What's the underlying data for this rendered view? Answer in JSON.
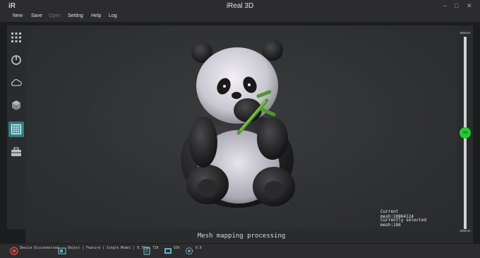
{
  "app": {
    "logo": "iR",
    "title": "iReal 3D"
  },
  "window_controls": {
    "minimize": "–",
    "maximize": "□",
    "close": "✕"
  },
  "menu": [
    {
      "label": "New",
      "enabled": true
    },
    {
      "label": "Save",
      "enabled": true
    },
    {
      "label": "Open",
      "enabled": false
    },
    {
      "label": "Setting",
      "enabled": true
    },
    {
      "label": "Help",
      "enabled": true
    },
    {
      "label": "Log",
      "enabled": true
    }
  ],
  "sidebar": {
    "items": [
      {
        "icon": "grid-dots-icon",
        "active": false
      },
      {
        "icon": "power-cycle-icon",
        "active": false
      },
      {
        "icon": "cloud-icon",
        "active": false
      },
      {
        "icon": "cube-icon",
        "active": false
      },
      {
        "icon": "mesh-grid-icon",
        "active": true
      },
      {
        "icon": "toolbox-icon",
        "active": false
      }
    ]
  },
  "viewport": {
    "current_mesh": "Current mesh:10864124",
    "selected_mesh": "Currently selected mesh:186"
  },
  "status_message": "Mesh mapping processing",
  "depth_slider": {
    "top_label": "600mm",
    "bottom_label": "200mm",
    "handle_label": "400",
    "value_fraction": 0.5
  },
  "bottom_bar": {
    "device_status": "Device Disconnected",
    "mode": "Object | Feature | Single Model | 0.70mm",
    "points": "72K",
    "frame": "63%",
    "version": "0.0"
  },
  "colors": {
    "accent": "#2c7f86",
    "slider_handle": "#22cc2a",
    "status_icon": "#d9453d"
  }
}
